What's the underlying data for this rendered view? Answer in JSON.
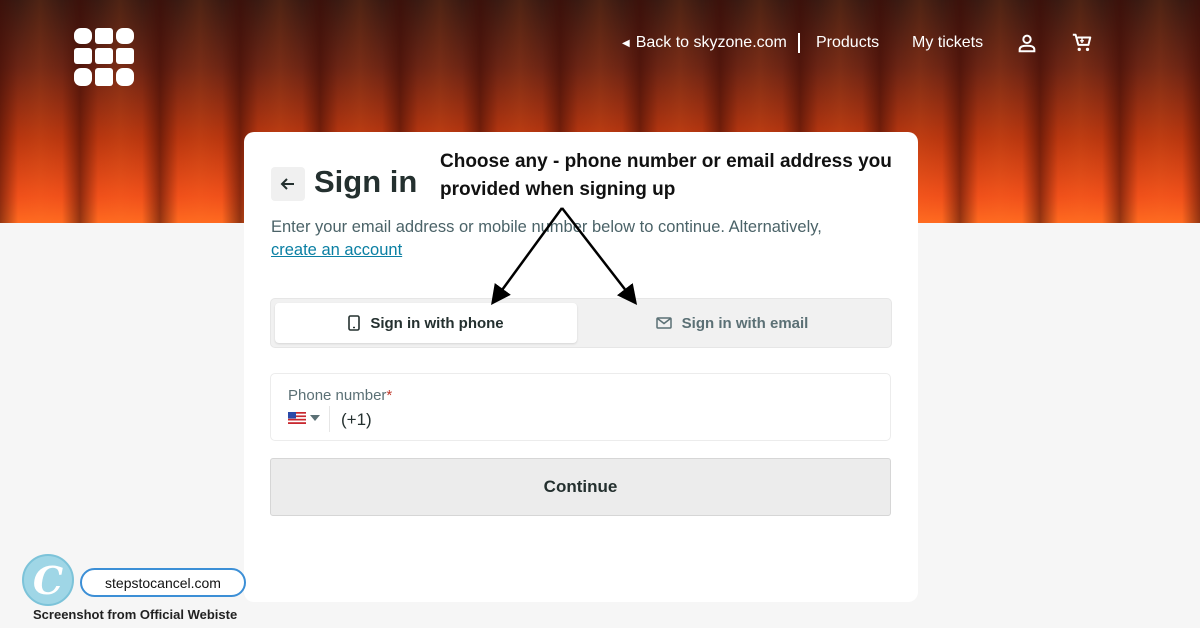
{
  "header": {
    "logo_icon": "skyzone-logo-icon",
    "back_link": "Back to skyzone.com",
    "products": "Products",
    "my_tickets": "My tickets",
    "user_icon": "user-icon",
    "cart_icon": "cart-icon"
  },
  "signin": {
    "back_icon": "arrow-left-icon",
    "title": "Sign in",
    "subtitle": "Enter your email address or mobile number below to continue. Alternatively,",
    "create_account": "create an account",
    "tabs": [
      {
        "label": "Sign in with phone",
        "icon": "phone-icon",
        "selected": true
      },
      {
        "label": "Sign in with email",
        "icon": "mail-icon",
        "selected": false
      }
    ],
    "phone_field": {
      "label": "Phone number",
      "required_mark": "*",
      "country_flag": "us-flag-icon",
      "value": "(+1)"
    },
    "continue_label": "Continue"
  },
  "annotation": {
    "text": "Choose any - phone number or email address you provided when signing up"
  },
  "watermark": {
    "logo_letter": "C",
    "site": "stepstocancel.com",
    "caption": "Screenshot from Official Webiste"
  },
  "colors": {
    "accent_link": "#0a7fa3",
    "hero_orange": "#f0501a",
    "required": "#c0392b"
  }
}
